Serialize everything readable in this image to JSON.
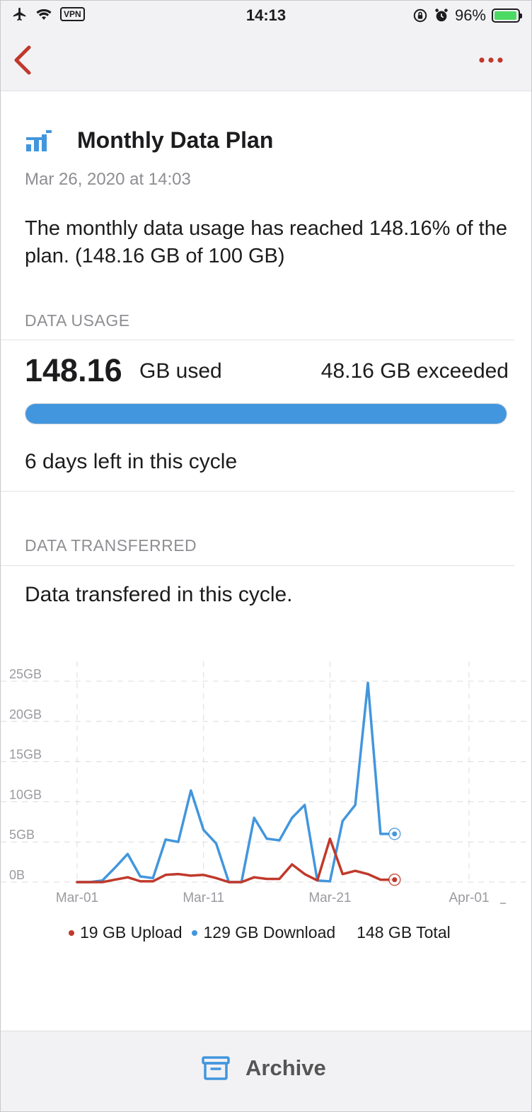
{
  "status_bar": {
    "time": "14:13",
    "vpn": "VPN",
    "battery": "96%",
    "battery_level": 0.96
  },
  "nav": {
    "back_icon": "chevron-left-icon",
    "more_icon": "ellipsis-icon",
    "accent_color": "#c0392b"
  },
  "notification": {
    "icon": "bar-chart-icon",
    "title": "Monthly Data Plan",
    "timestamp": "Mar 26, 2020 at 14:03",
    "message": "The monthly data usage has reached 148.16% of the plan. (148.16 GB of 100 GB)"
  },
  "data_usage": {
    "header": "DATA USAGE",
    "used_value": "148.16",
    "used_unit": "GB used",
    "exceeded": "48.16 GB exceeded",
    "progress_fraction": 1.0,
    "progress_color": "#4296dd",
    "days_left": "6 days left in this cycle"
  },
  "data_transferred": {
    "header": "DATA TRANSFERRED",
    "subtitle": "Data transfered in this cycle."
  },
  "chart_data": {
    "type": "line",
    "x_ticks": [
      "Mar-01",
      "Mar-11",
      "Mar-21",
      "Apr-01"
    ],
    "y_ticks": [
      "0B",
      "5GB",
      "10GB",
      "15GB",
      "20GB",
      "25GB"
    ],
    "ylim": [
      0,
      25
    ],
    "xlabel": "",
    "ylabel": "",
    "grid": true,
    "x": [
      "Mar-01",
      "Mar-02",
      "Mar-03",
      "Mar-04",
      "Mar-05",
      "Mar-06",
      "Mar-07",
      "Mar-08",
      "Mar-09",
      "Mar-10",
      "Mar-11",
      "Mar-12",
      "Mar-13",
      "Mar-14",
      "Mar-15",
      "Mar-16",
      "Mar-17",
      "Mar-18",
      "Mar-19",
      "Mar-20",
      "Mar-21",
      "Mar-22",
      "Mar-23",
      "Mar-24",
      "Mar-25",
      "Mar-26"
    ],
    "series": [
      {
        "name": "Download",
        "color": "#4296dd",
        "values": [
          0,
          0,
          0.2,
          1.8,
          3.5,
          0.7,
          0.5,
          5.3,
          5.0,
          11.4,
          6.5,
          4.8,
          0,
          0,
          8.0,
          5.4,
          5.2,
          8.0,
          9.6,
          0.2,
          0.1,
          7.6,
          9.6,
          24.8,
          6.0,
          6.0
        ]
      },
      {
        "name": "Upload",
        "color": "#c0392b",
        "values": [
          0,
          0,
          0,
          0.3,
          0.6,
          0.1,
          0.1,
          0.9,
          1.0,
          0.8,
          0.9,
          0.5,
          0,
          0,
          0.6,
          0.4,
          0.4,
          2.2,
          1.0,
          0.2,
          5.4,
          1.0,
          1.4,
          1.0,
          0.3,
          0.3
        ]
      }
    ],
    "legend": {
      "upload": "19 GB Upload",
      "download": "129 GB Download",
      "total": "148 GB Total",
      "placement": "bottom"
    }
  },
  "toolbar": {
    "archive_icon": "archive-box-icon",
    "archive_label": "Archive",
    "icon_color": "#4296dd"
  }
}
